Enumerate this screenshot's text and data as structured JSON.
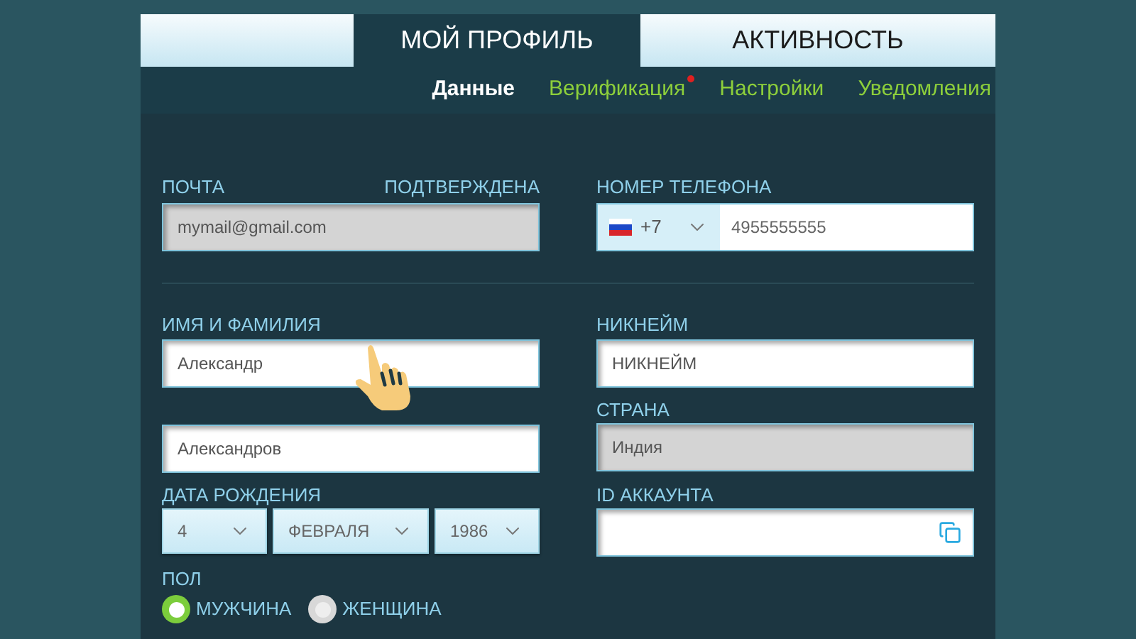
{
  "tabs": [
    {
      "label": "МОЙ ПРОФИЛЬ",
      "selected": true
    },
    {
      "label": "АКТИВНОСТЬ",
      "selected": false
    }
  ],
  "subtabs": [
    {
      "label": "Данные",
      "selected": true,
      "alert": false
    },
    {
      "label": "Верификация",
      "selected": false,
      "alert": true
    },
    {
      "label": "Настройки",
      "selected": false,
      "alert": false
    },
    {
      "label": "Уведомления",
      "selected": false,
      "alert": false
    }
  ],
  "email": {
    "label": "ПОЧТА",
    "status": "ПОДТВЕРЖДЕНА",
    "value": "mymail@gmail.com",
    "disabled": true
  },
  "phone": {
    "label": "НОМЕР ТЕЛЕФОНА",
    "code": "+7",
    "value": "4955555555"
  },
  "name": {
    "label": "ИМЯ И ФАМИЛИЯ",
    "first": "Александр",
    "last": "Александров"
  },
  "nickname": {
    "label": "НИКНЕЙМ",
    "placeholder": "НИКНЕЙМ"
  },
  "country": {
    "label": "СТРАНА",
    "value": "Индия",
    "disabled": true
  },
  "birth": {
    "label": "ДАТА РОЖДЕНИЯ",
    "day": "4",
    "month": "ФЕВРАЛЯ",
    "year": "1986"
  },
  "account_id": {
    "label": "ID АККАУНТА"
  },
  "gender": {
    "label": "ПОЛ",
    "options": [
      {
        "label": "МУЖЧИНА",
        "selected": true
      },
      {
        "label": "ЖЕНЩИНА",
        "selected": false
      }
    ]
  }
}
